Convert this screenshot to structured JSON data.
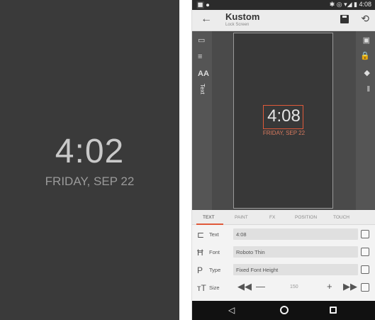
{
  "lock_screen": {
    "time": "4:02",
    "date": "FRIDAY, SEP 22"
  },
  "status_bar": {
    "left_icons": "🔲 ⏺",
    "right_text": "✱ ◎ ▾◢ ▮ 4:08"
  },
  "app_bar": {
    "back_icon": "←",
    "title": "Kustom",
    "subtitle": "Lock Screen",
    "save_icon": "save-icon",
    "history_icon": "⟲"
  },
  "left_tools": {
    "text_label": "Text"
  },
  "canvas": {
    "time": "4:08",
    "date": "FRIDAY, SEP 22"
  },
  "tabs": [
    {
      "label": "TEXT",
      "active": true
    },
    {
      "label": "PAINT",
      "active": false
    },
    {
      "label": "FX",
      "active": false
    },
    {
      "label": "POSITION",
      "active": false
    },
    {
      "label": "TOUCH",
      "active": false
    }
  ],
  "properties": {
    "text": {
      "label": "Text",
      "value": "4:08"
    },
    "font": {
      "label": "Font",
      "value": "Roboto Thin"
    },
    "type": {
      "label": "Type",
      "value": "Fixed Font Height"
    },
    "size": {
      "label": "Size",
      "value": "150"
    }
  },
  "colors": {
    "accent": "#e05a3a",
    "lock_bg": "#3a3a3a",
    "editor_bg": "#4a4a4a"
  }
}
